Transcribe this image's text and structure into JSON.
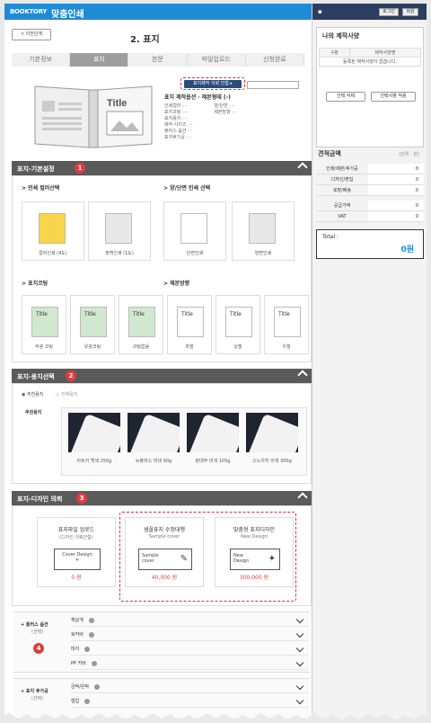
{
  "header": {
    "brand": "BOOKTORY",
    "app_title": "맞춤인쇄",
    "prev_button": "< 이전단계",
    "page_title": "2. 표지"
  },
  "steps": [
    "기본정보",
    "표지",
    "본문",
    "파일업로드",
    "신청완료"
  ],
  "active_step": 1,
  "cover_preview": {
    "title_text": "Title"
  },
  "promo": {
    "button": "표지제작 의뢰 안함 ▸"
  },
  "specs": {
    "heading": "표지 제작옵션 · 제본형태 (-)",
    "left": [
      "인쇄컬러 : -",
      "표지코팅 : -",
      "표지용지 : -",
      "제작 사이즈 : -",
      "플러스 옵션 : -",
      "표지후가공 : -"
    ],
    "right": [
      "양/단면 : -",
      "제본방향 : -"
    ]
  },
  "sections": {
    "basic": {
      "title": "표지-기본설정",
      "badge": "1"
    },
    "paper": {
      "title": "표지-용지선택",
      "badge": "2"
    },
    "design": {
      "title": "표지-디자인 의뢰",
      "badge": "3"
    }
  },
  "basic": {
    "color_label": "> 인쇄 컬러선택",
    "side_label": "> 양/단면 인쇄 선택",
    "coating_label": "> 표지코팅",
    "binding_label": "> 제본방향",
    "color_options": [
      "컬러인쇄 (4도)",
      "흑백인쇄 (1도)"
    ],
    "side_options": [
      "단면인쇄",
      "양면인쇄"
    ],
    "coating_options": [
      "무광 코팅",
      "유광코팅",
      "코팅없음"
    ],
    "binding_options": [
      "좌철",
      "상철",
      "우철"
    ],
    "book_title": "Title"
  },
  "paper": {
    "radio_recommended": "추천용지",
    "radio_all": "전체용지",
    "recommended_label": "추천용지",
    "items": [
      "아트지 백색 250g",
      "뉴플러스 미색 90g",
      "랑데부 미색 105g",
      "스노우지 미색 300g"
    ]
  },
  "design": {
    "cards": [
      {
        "t1": "표지파일 업로드",
        "t2": "(디자인 의뢰안함)",
        "box": "Cover Design",
        "price": "0 원"
      },
      {
        "t1": "샘플표지 수정대행",
        "t2": "Sample cover",
        "box": "Sample cover",
        "price": "40,000 원"
      },
      {
        "t1": "맞춤형 표지디자인",
        "t2": "New Design",
        "box": "New Design",
        "price": "300,000 원"
      }
    ]
  },
  "plus_option": {
    "label": "+ 플러스 옵션",
    "sub": "(선택)",
    "badge": "4",
    "rows": [
      "책날개",
      "북커버",
      "띠지",
      "PP 커버"
    ]
  },
  "post_option": {
    "label": "+ 표지 후가공",
    "sub": "(선택)",
    "rows": [
      "금박/은박",
      "형압"
    ]
  },
  "sidebar": {
    "login": "로그인",
    "join": "회원",
    "my_spec_title": "나의 제작사양",
    "table_headers": [
      "구분",
      "제작사양명"
    ],
    "empty_text": "등록된 제작사양이 없습니다.",
    "delete_button": "선택 삭제",
    "apply_button": "선택사항 적용",
    "estimate_title": "견적금액",
    "unit": "(단위 : 원)",
    "estimate_rows": [
      {
        "k": "인쇄/제본/후가공",
        "v": "0"
      },
      {
        "k": "디자인/편집",
        "v": "0"
      },
      {
        "k": "포장/배송",
        "v": "0"
      },
      {
        "k": "공급가액",
        "v": "0"
      },
      {
        "k": "VAT",
        "v": "0"
      }
    ],
    "total_label": "Total :",
    "total_value": "0원"
  },
  "colors": {
    "brand": "#1f8bd6",
    "section": "#5a5a5a",
    "badge": "#e03c42",
    "navy": "#2b3e5f"
  }
}
